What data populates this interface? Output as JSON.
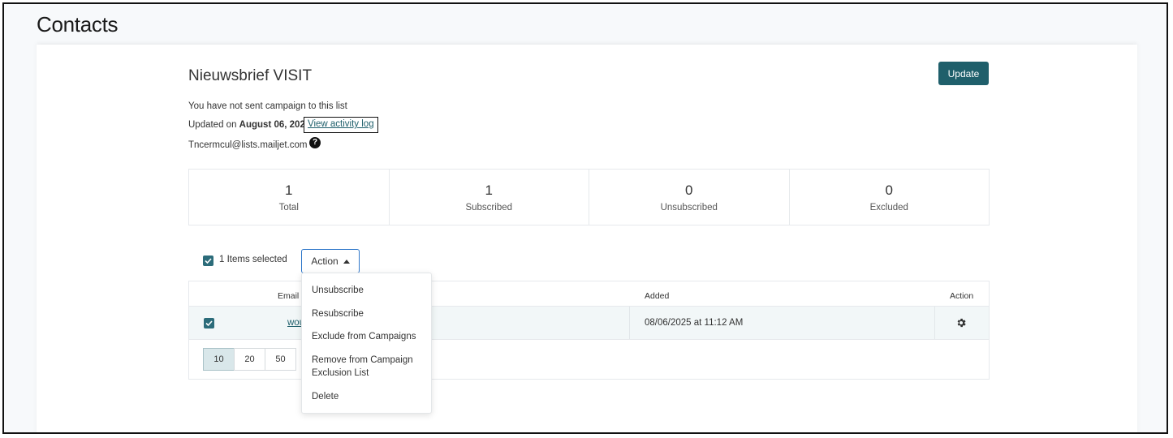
{
  "page": {
    "title": "Contacts"
  },
  "list": {
    "name": "Nieuwsbrief VISIT",
    "campaign_status": "You have not sent campaign to this list",
    "updated_prefix": "Updated on",
    "updated_date": "August 06, 2025",
    "activity_link": "View activity log",
    "list_email": "Tncermcul@lists.mailjet.com",
    "help_icon": "?"
  },
  "toolbar": {
    "update_label": "Update"
  },
  "stats": [
    {
      "value": "1",
      "label": "Total"
    },
    {
      "value": "1",
      "label": "Subscribed"
    },
    {
      "value": "0",
      "label": "Unsubscribed"
    },
    {
      "value": "0",
      "label": "Excluded"
    }
  ],
  "selection": {
    "count_text": "1 Items selected",
    "action_label": "Action"
  },
  "table": {
    "headers": {
      "email": "Email",
      "added": "Added",
      "action": "Action"
    },
    "rows": [
      {
        "email": "wou",
        "added": "08/06/2025 at 11:12 AM",
        "checked": true
      }
    ]
  },
  "pagination": {
    "sizes": [
      "10",
      "20",
      "50"
    ],
    "active": "10"
  },
  "action_menu": {
    "items": [
      "Unsubscribe",
      "Resubscribe",
      "Exclude from Campaigns",
      "Remove from Campaign Exclusion List",
      "Delete"
    ]
  },
  "colors": {
    "primary": "#1f5f6b",
    "checkbox": "#2c6c7a",
    "focus_border": "#2f77c9",
    "row_highlight": "#f2f7f8"
  }
}
